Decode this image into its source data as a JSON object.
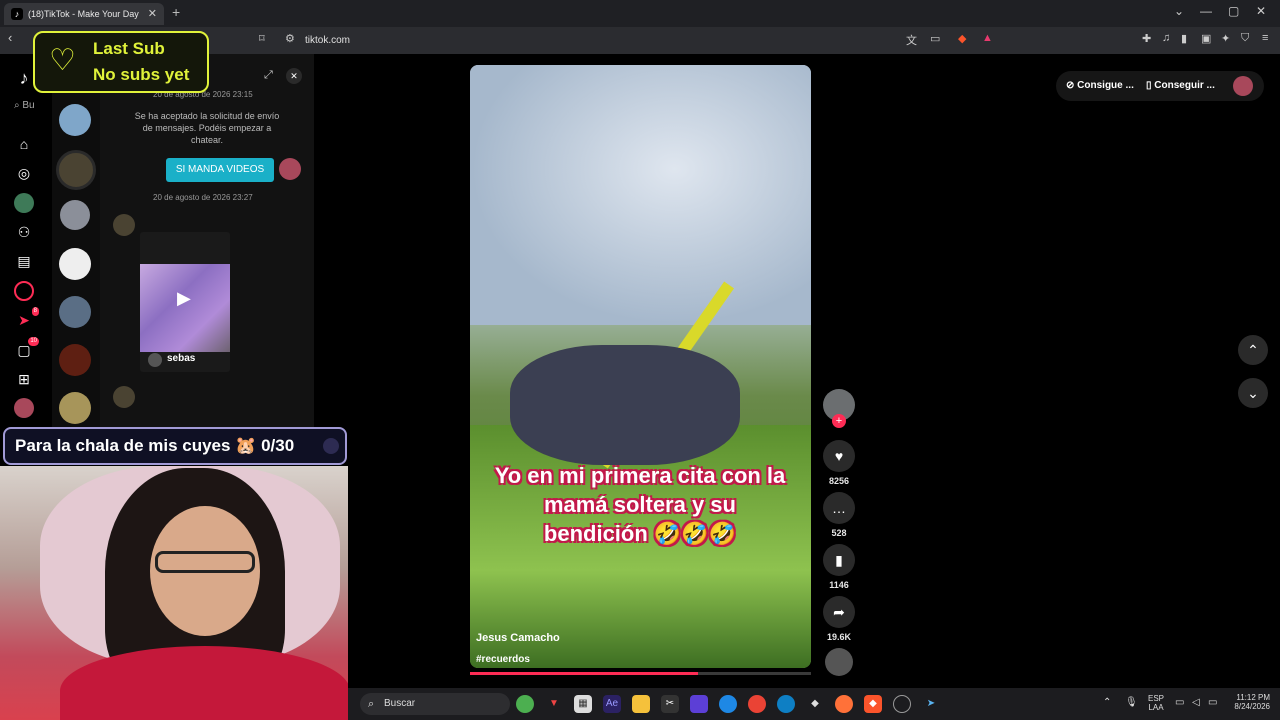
{
  "browser": {
    "tab_title": "(18)TikTok - Make Your Day",
    "tab_close": "✕",
    "new_tab": "+",
    "url": "tiktok.com",
    "window_controls": [
      "⌄",
      "—",
      "▢",
      "✕"
    ]
  },
  "overlay": {
    "last_sub_title": "Last Sub",
    "last_sub_value": "No subs yet",
    "goal_text": "Para la chala de mis cuyes 🐹 0/30"
  },
  "leftnav": {
    "search_placeholder": "Bu",
    "badges": {
      "inbox": "8",
      "messages": "10"
    }
  },
  "chat": {
    "top_timestamp": "20 de agosto de 2026 23:15",
    "system_message": "Se ha aceptado la solicitud de envío de mensajes. Podéis empezar a chatear.",
    "bubble": "SI MANDA VIDEOS",
    "timestamp": "20 de agosto de 2026 23:27",
    "shared_video_author": "sebas"
  },
  "video": {
    "caption": "Yo en mi primera cita con la mamá soltera y su bendición 🤣🤣🤣",
    "author": "Jesus Camacho",
    "hashtag": "#recuerdos",
    "progress": 0.67,
    "likes": "8256",
    "comments": "528",
    "saves": "1146",
    "shares": "19.6K"
  },
  "top_right": {
    "coins_label": "Consigue ...",
    "app_label": "Conseguir ..."
  },
  "taskbar": {
    "search_label": "Buscar",
    "lang_line1": "ESP",
    "lang_line2": "LAA",
    "time": "11:12 PM",
    "date": "8/24/2026"
  }
}
